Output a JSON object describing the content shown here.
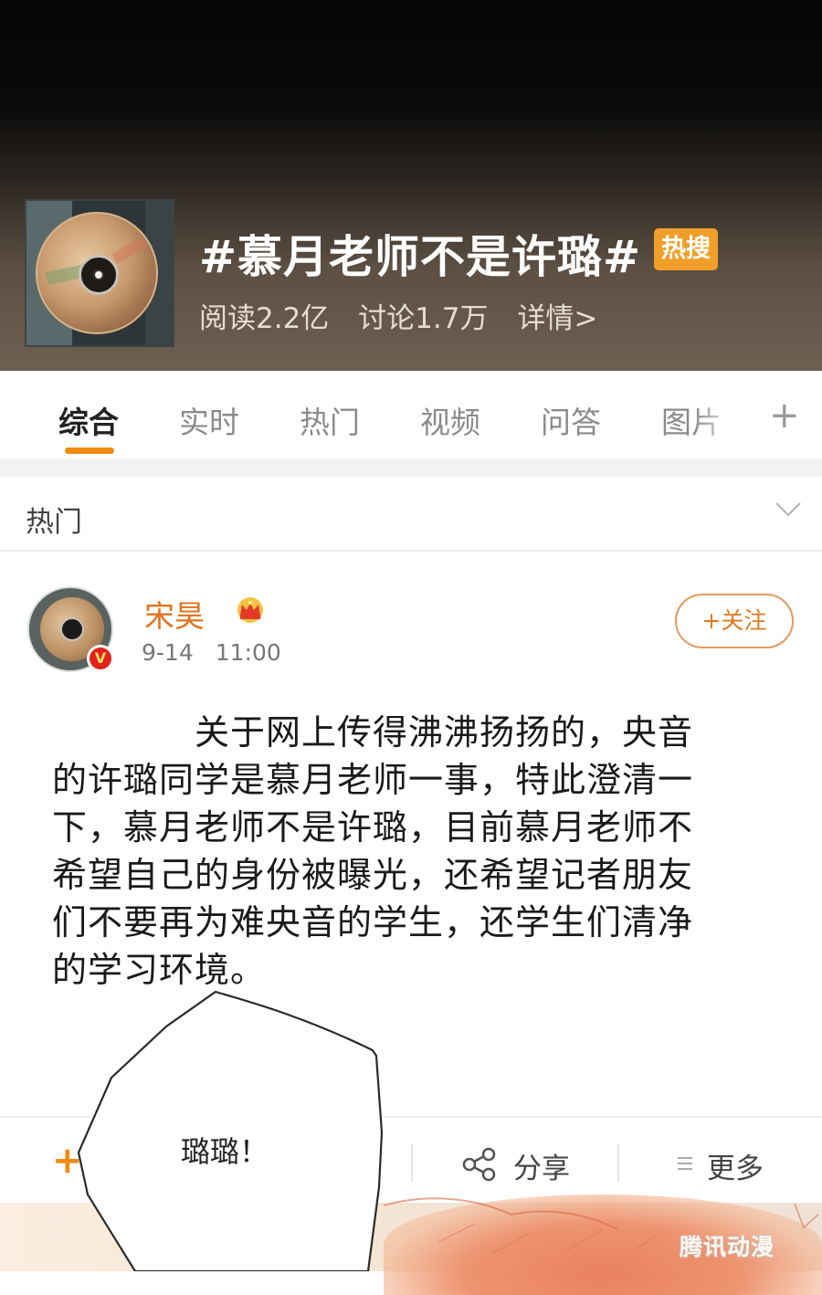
{
  "topic": {
    "title": "#慕月老师不是许璐#",
    "badge": "热搜",
    "stats": {
      "reads": "阅读2.2亿",
      "discussions": "讨论1.7万",
      "details": "详情>"
    }
  },
  "tabs": [
    {
      "label": "综合",
      "active": true
    },
    {
      "label": "实时",
      "active": false
    },
    {
      "label": "热门",
      "active": false
    },
    {
      "label": "视频",
      "active": false
    },
    {
      "label": "问答",
      "active": false
    },
    {
      "label": "图片",
      "active": false
    }
  ],
  "tab_add_icon": "plus-icon",
  "hot_section": {
    "label": "热门",
    "toggle_icon": "chevron-down-icon"
  },
  "post": {
    "username": "宋昊",
    "badge_icon": "crown-icon",
    "verified_icon": "verified-v-badge",
    "date": "9-14",
    "time": "11:00",
    "follow_label": "+关注",
    "text_lines": [
      "　　　　关于网上传得沸沸扬扬的，央音",
      "的许璐同学是慕月老师一事，特此澄清一",
      "下，慕月老师不是许璐，目前慕月老师不",
      "希望自己的身份被曝光，还希望记者朋友",
      "们不要再为难央音的学生，还学生们清净",
      "的学习环境。"
    ]
  },
  "actions": {
    "repost_icon": "plus-icon",
    "share_icon": "share-icon",
    "share_label": "分享",
    "more_icon": "menu-icon",
    "more_label": "更多"
  },
  "comic": {
    "speech": "璐璐！",
    "watermark": "腾讯动漫"
  },
  "colors": {
    "accent_orange": "#f08a12",
    "username_orange": "#e0731c",
    "hot_badge": "#f0a02a"
  }
}
